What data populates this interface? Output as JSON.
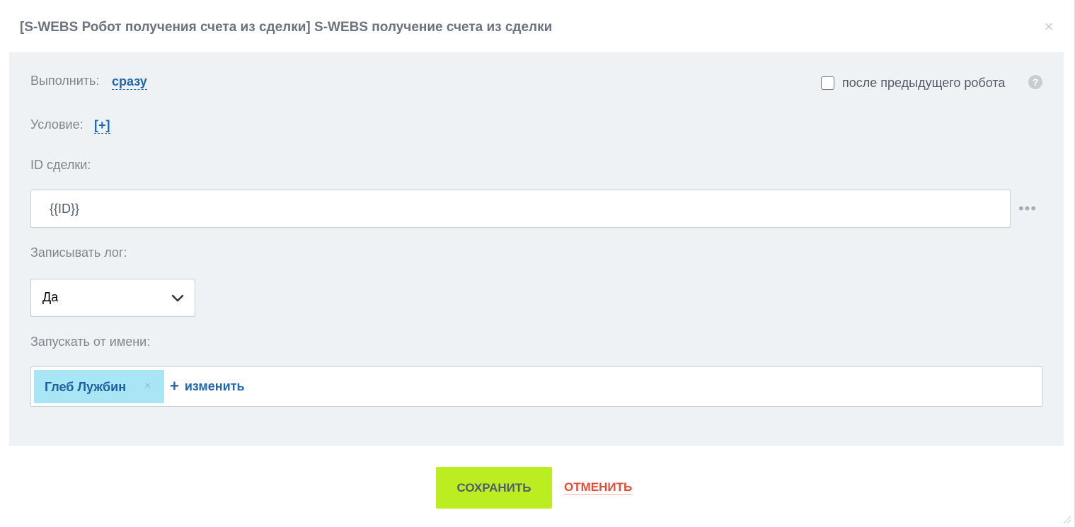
{
  "dialog": {
    "title": "[S-WEBS Робот получения счета из сделки] S-WEBS получение счета из сделки",
    "close_glyph": "×"
  },
  "execute": {
    "label": "Выполнить:",
    "value": "сразу"
  },
  "after_previous": {
    "label": "после предыдущего робота",
    "checked": false,
    "help_glyph": "?"
  },
  "condition": {
    "label": "Условие:",
    "add_label": "[+]"
  },
  "deal_id": {
    "label": "ID сделки:",
    "value": "{{ID}}",
    "more_glyph": "•••"
  },
  "write_log": {
    "label": "Записывать лог:",
    "selected": "Да"
  },
  "run_as": {
    "label": "Запускать от имени:",
    "user_name": "Глеб Лужбин",
    "remove_glyph": "×",
    "change_plus": "+",
    "change_label": "изменить"
  },
  "footer": {
    "save_label": "СОХРАНИТЬ",
    "cancel_label": "ОТМЕНИТЬ"
  },
  "colors": {
    "accent_blue": "#2067b0",
    "save_green": "#bbed21",
    "cancel_red": "#e54c3a",
    "body_bg": "#eef2f4",
    "chip_bg": "#a8e6f6"
  }
}
